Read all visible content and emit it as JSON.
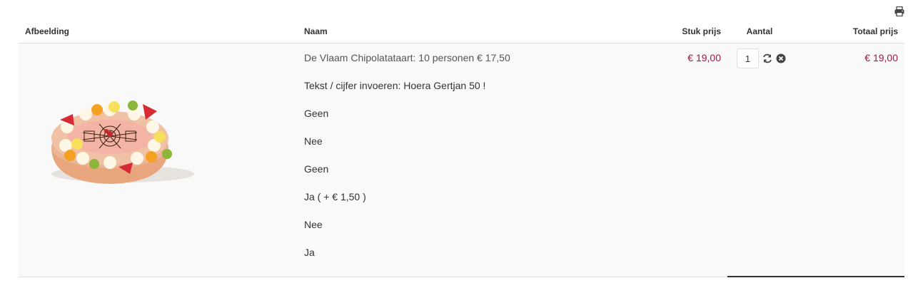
{
  "toolbar": {
    "print_icon": "print-icon"
  },
  "table": {
    "headers": {
      "image": "Afbeelding",
      "name": "Naam",
      "unit_price": "Stuk prijs",
      "quantity": "Aantal",
      "total_price": "Totaal prijs"
    },
    "item": {
      "image_alt": "De Vlaam Chipolatataart",
      "title": "De Vlaam Chipolatataart: 10 personen € 17,50",
      "options": [
        "Tekst / cijfer invoeren: Hoera Gertjan 50 !",
        "Geen",
        "Nee",
        "Geen",
        "Ja ( + € 1,50 )",
        "Nee",
        "Ja"
      ],
      "unit_price": "€ 19,00",
      "quantity": "1",
      "total_price": "€ 19,00",
      "update_icon": "refresh-icon",
      "remove_icon": "remove-icon"
    }
  },
  "colors": {
    "price": "#a4163f",
    "row_bg": "#f9f9f9",
    "text": "#333333"
  }
}
